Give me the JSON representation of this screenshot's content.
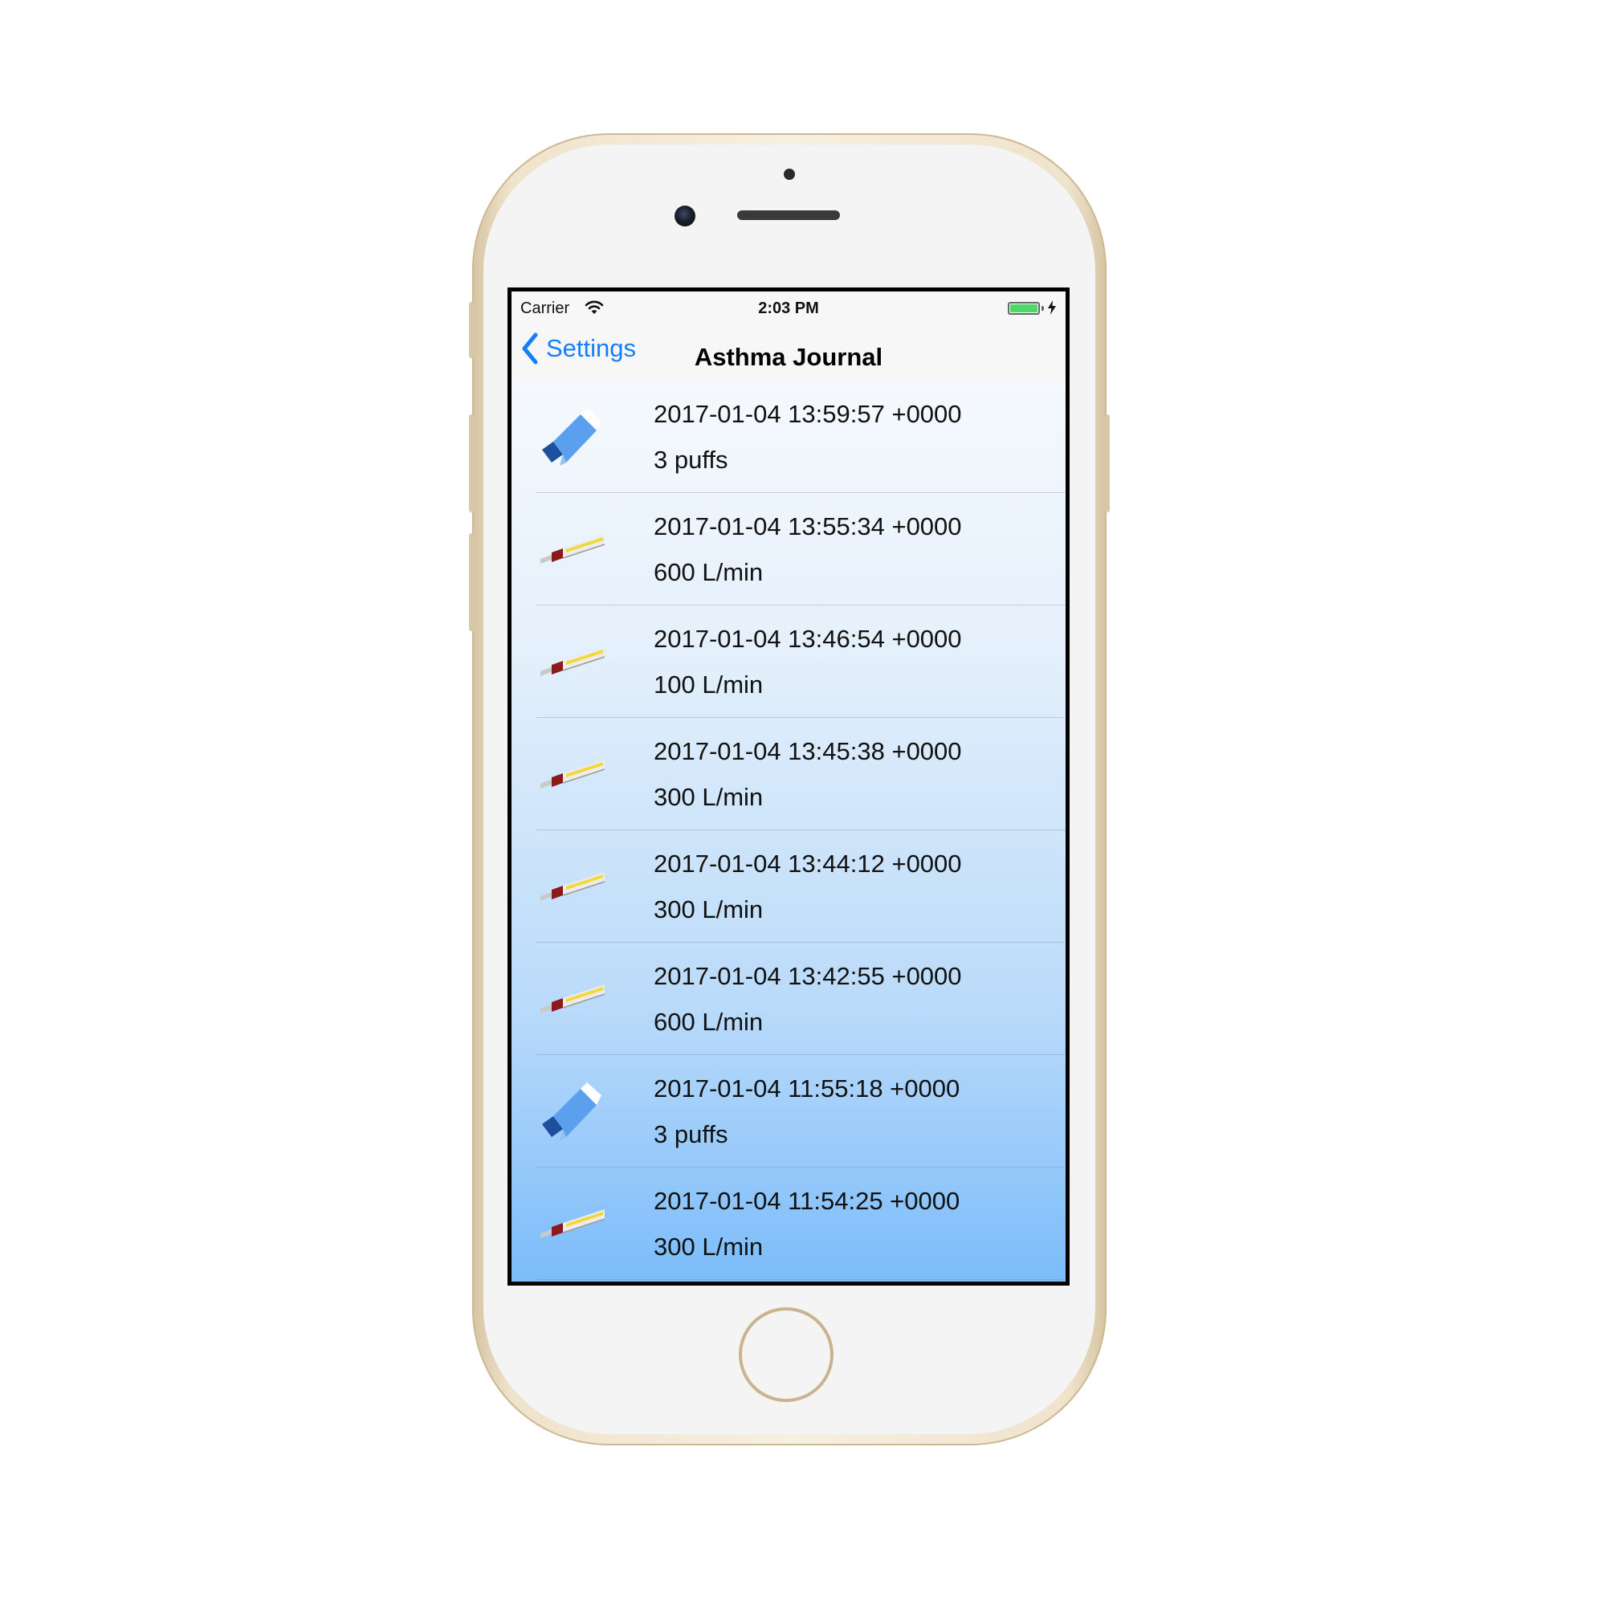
{
  "status_bar": {
    "carrier": "Carrier",
    "time": "2:03 PM",
    "battery_level": 1.0,
    "charging": true,
    "battery_color": "#4cd964"
  },
  "nav": {
    "back_label": "Settings",
    "title": "Asthma Journal",
    "accent_color": "#157efb"
  },
  "entries": [
    {
      "type": "inhaler-icon",
      "date": "2017-01-04 13:59:57 +0000",
      "value": "3 puffs"
    },
    {
      "type": "peak-flow-meter-icon",
      "date": "2017-01-04 13:55:34 +0000",
      "value": "600 L/min"
    },
    {
      "type": "peak-flow-meter-icon",
      "date": "2017-01-04 13:46:54 +0000",
      "value": "100 L/min"
    },
    {
      "type": "peak-flow-meter-icon",
      "date": "2017-01-04 13:45:38 +0000",
      "value": "300 L/min"
    },
    {
      "type": "peak-flow-meter-icon",
      "date": "2017-01-04 13:44:12 +0000",
      "value": "300 L/min"
    },
    {
      "type": "peak-flow-meter-icon",
      "date": "2017-01-04 13:42:55 +0000",
      "value": "600 L/min"
    },
    {
      "type": "inhaler-icon",
      "date": "2017-01-04 11:55:18 +0000",
      "value": "3 puffs"
    },
    {
      "type": "peak-flow-meter-icon",
      "date": "2017-01-04 11:54:25 +0000",
      "value": "300 L/min"
    }
  ]
}
